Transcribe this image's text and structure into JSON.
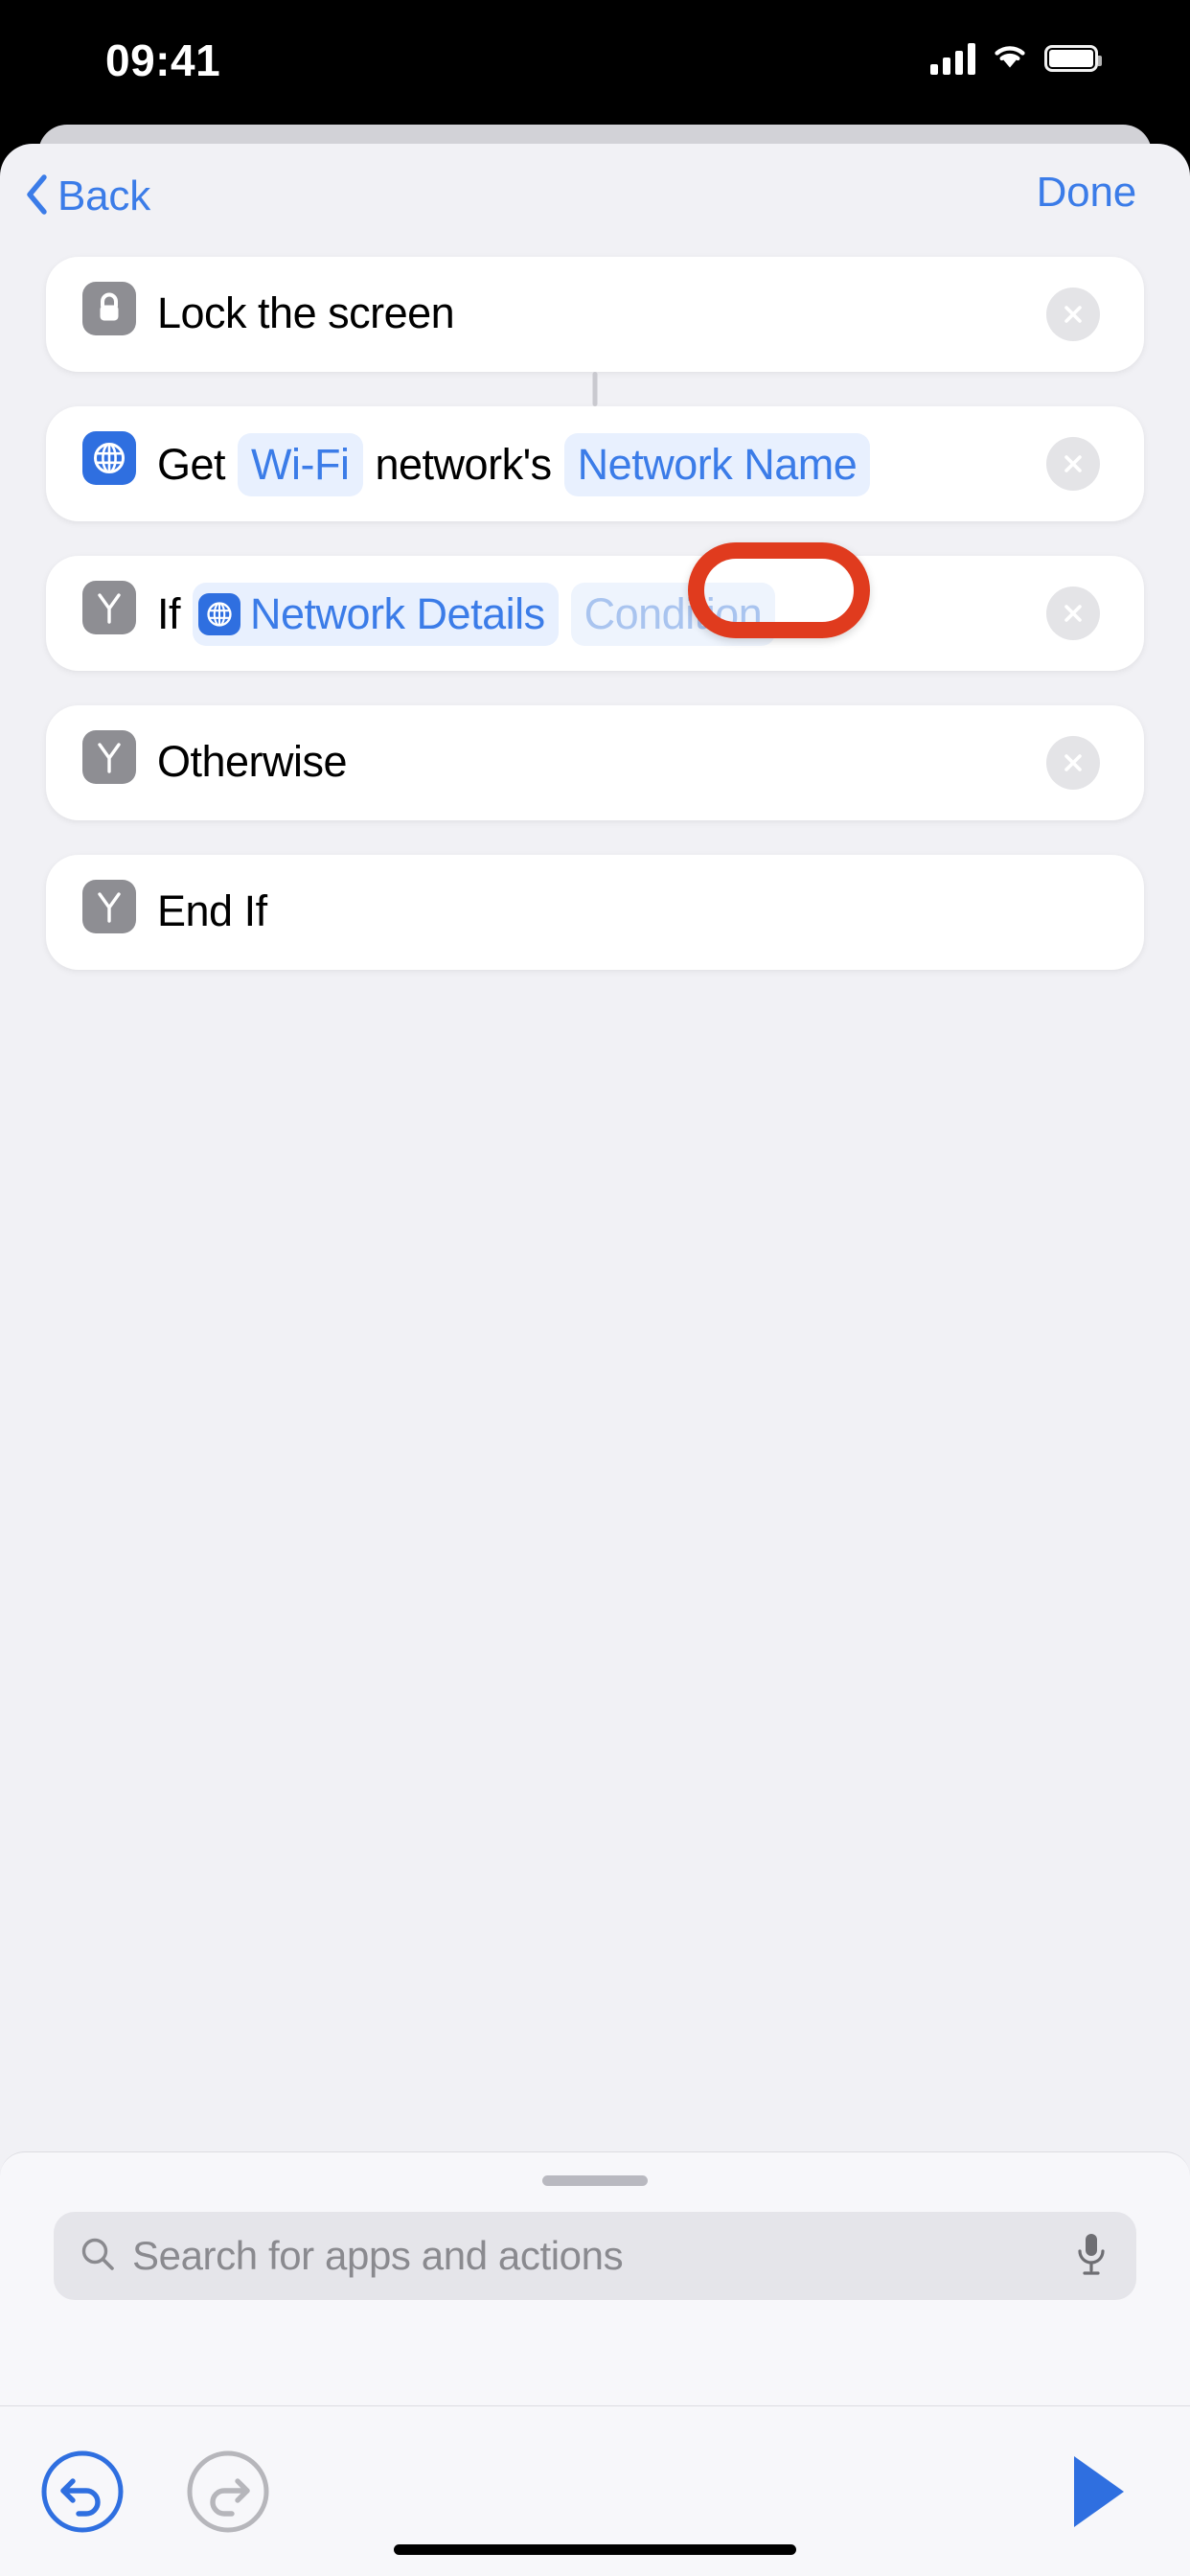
{
  "status_bar": {
    "time": "09:41",
    "signal_icon": "cellular-signal-icon",
    "wifi_icon": "wifi-icon",
    "battery_icon": "battery-full-icon"
  },
  "nav": {
    "back_label": "Back",
    "back_icon": "chevron-left-icon",
    "done_label": "Done"
  },
  "theme": {
    "accent_blue": "#3b7ce8",
    "token_blue": "#2f6fe0",
    "token_bg": "#e8f0fe",
    "placeholder_blue": "#a9c4ef",
    "icon_gray": "#8e8e93",
    "annotation_red": "#e03b1e",
    "sheet_bg": "#f1f1f5",
    "card_bg": "#ffffff"
  },
  "actions": [
    {
      "id": "lock-screen",
      "icon": "lock-icon",
      "icon_style": "gray",
      "segments": [
        {
          "type": "text",
          "value": "Lock the screen"
        }
      ],
      "deletable": true
    },
    {
      "id": "get-wifi-network-detail",
      "icon": "globe-icon",
      "icon_style": "blue",
      "segments": [
        {
          "type": "text",
          "value": "Get"
        },
        {
          "type": "token",
          "value": "Wi-Fi"
        },
        {
          "type": "text",
          "value": "network's"
        },
        {
          "type": "token",
          "value": "Network Name"
        }
      ],
      "deletable": true
    },
    {
      "id": "if-condition",
      "icon": "branch-icon",
      "icon_style": "gray",
      "segments": [
        {
          "type": "text",
          "value": "If"
        },
        {
          "type": "token-icon",
          "value": "Network Details",
          "icon": "globe-icon"
        },
        {
          "type": "token-placeholder",
          "value": "Condition"
        }
      ],
      "deletable": true,
      "annotated": true
    },
    {
      "id": "otherwise",
      "icon": "branch-icon",
      "icon_style": "gray",
      "segments": [
        {
          "type": "text",
          "value": "Otherwise"
        }
      ],
      "deletable": true
    },
    {
      "id": "end-if",
      "icon": "branch-icon",
      "icon_style": "gray",
      "segments": [
        {
          "type": "text",
          "value": "End If"
        }
      ],
      "deletable": false
    }
  ],
  "search": {
    "placeholder": "Search for apps and actions",
    "search_icon": "search-icon",
    "mic_icon": "microphone-icon"
  },
  "toolbar": {
    "undo_icon": "undo-icon",
    "undo_enabled": true,
    "redo_icon": "redo-icon",
    "redo_enabled": false,
    "play_icon": "play-icon"
  }
}
